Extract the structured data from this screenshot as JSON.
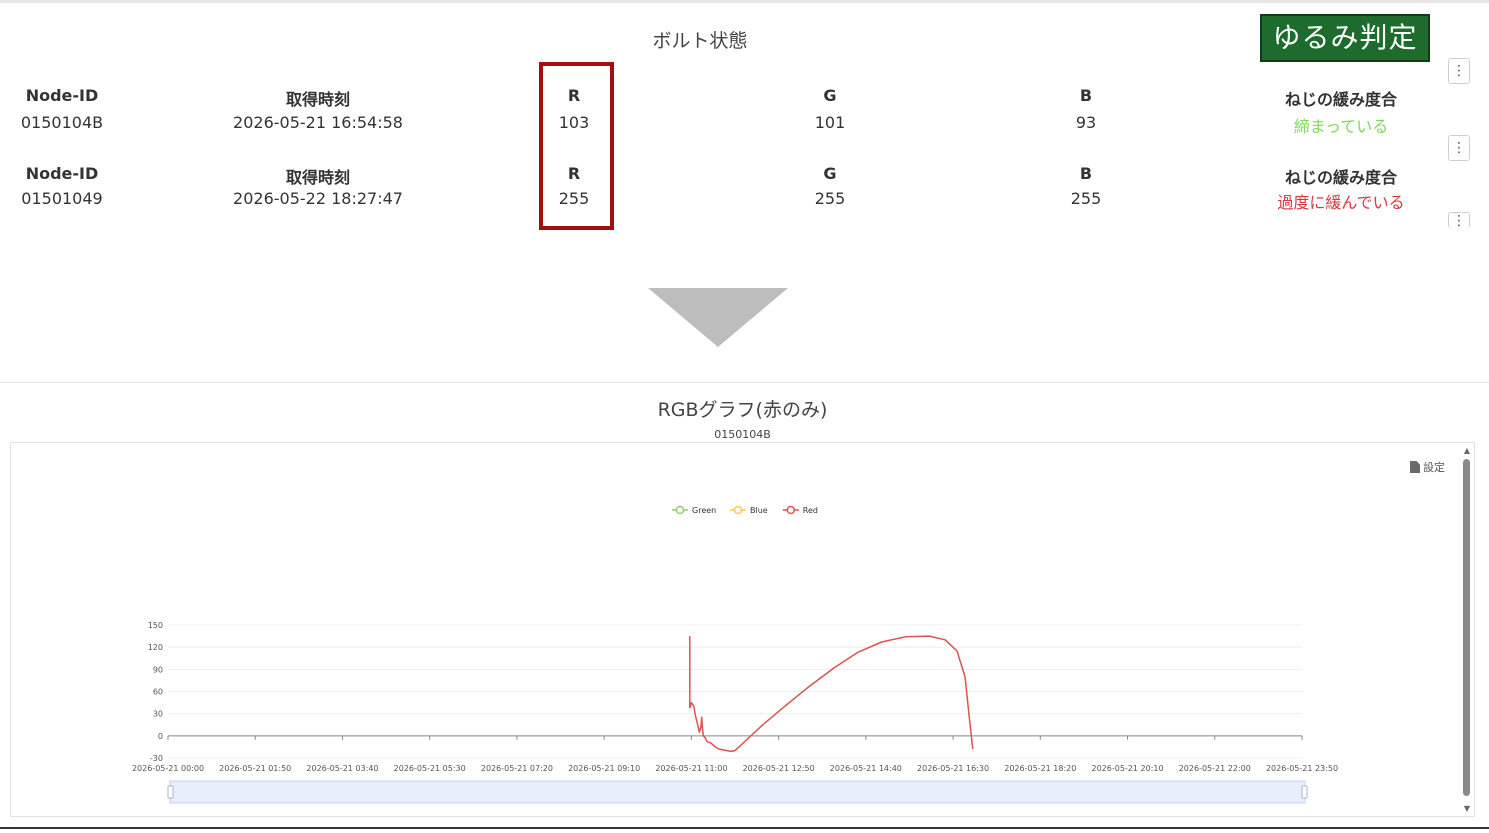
{
  "bolt_panel": {
    "title": "ボルト状態",
    "judge_button": "ゆるみ判定",
    "headers": {
      "node_id": "Node-ID",
      "time": "取得時刻",
      "r": "R",
      "g": "G",
      "b": "B",
      "loosen": "ねじの緩み度合"
    },
    "rows": [
      {
        "node_id": "0150104B",
        "time": "2026-05-21 16:54:58",
        "r": "103",
        "g": "101",
        "b": "93",
        "status": "締まっている",
        "status_color": "#7ed957"
      },
      {
        "node_id": "01501049",
        "time": "2026-05-22 18:27:47",
        "r": "255",
        "g": "255",
        "b": "255",
        "status": "過度に緩んでいる",
        "status_color": "#d9363e"
      }
    ],
    "highlight_color": "#a01010"
  },
  "graph_panel": {
    "title": "RGBグラフ(赤のみ)",
    "subtitle": "0150104B",
    "settings_label": "設定"
  },
  "chart_data": {
    "type": "line",
    "legend": [
      "Green",
      "Blue",
      "Red"
    ],
    "legend_position": "top-center",
    "legend_colors": {
      "Green": "#91cc75",
      "Blue": "#fac858",
      "Red": "#d9534f"
    },
    "x_ticks": [
      "2026-05-21 00:00",
      "2026-05-21 01:50",
      "2026-05-21 03:40",
      "2026-05-21 05:30",
      "2026-05-21 07:20",
      "2026-05-21 09:10",
      "2026-05-21 11:00",
      "2026-05-21 12:50",
      "2026-05-21 14:40",
      "2026-05-21 16:30",
      "2026-05-21 18:20",
      "2026-05-21 20:10",
      "2026-05-21 22:00",
      "2026-05-21 23:50"
    ],
    "y_ticks": [
      -30,
      0,
      30,
      60,
      90,
      120,
      150
    ],
    "ylim": [
      -30,
      150
    ],
    "grid": true,
    "series": [
      {
        "name": "Red",
        "color": "#d9534f",
        "x": [
          "2026-05-21 10:58",
          "2026-05-21 10:58",
          "2026-05-21 11:00",
          "2026-05-21 11:03",
          "2026-05-21 11:05",
          "2026-05-21 11:08",
          "2026-05-21 11:10",
          "2026-05-21 11:12",
          "2026-05-21 11:13",
          "2026-05-21 11:14",
          "2026-05-21 11:15",
          "2026-05-21 11:17",
          "2026-05-21 11:20",
          "2026-05-21 11:25",
          "2026-05-21 11:30",
          "2026-05-21 11:35",
          "2026-05-21 11:45",
          "2026-05-21 11:50",
          "2026-05-21 11:55",
          "2026-05-21 12:00",
          "2026-05-21 12:10",
          "2026-05-21 12:30",
          "2026-05-21 13:00",
          "2026-05-21 13:30",
          "2026-05-21 14:00",
          "2026-05-21 14:30",
          "2026-05-21 15:00",
          "2026-05-21 15:30",
          "2026-05-21 16:00",
          "2026-05-21 16:20",
          "2026-05-21 16:35",
          "2026-05-21 16:45",
          "2026-05-21 16:50",
          "2026-05-21 16:54",
          "2026-05-21 16:55"
        ],
        "values": [
          135,
          38,
          45,
          40,
          28,
          15,
          5,
          12,
          25,
          10,
          0,
          -2,
          -8,
          -10,
          -15,
          -18,
          -20,
          -21,
          -20,
          -15,
          -5,
          15,
          42,
          68,
          92,
          113,
          127,
          134,
          135,
          130,
          115,
          80,
          30,
          -10,
          -18
        ]
      }
    ]
  }
}
